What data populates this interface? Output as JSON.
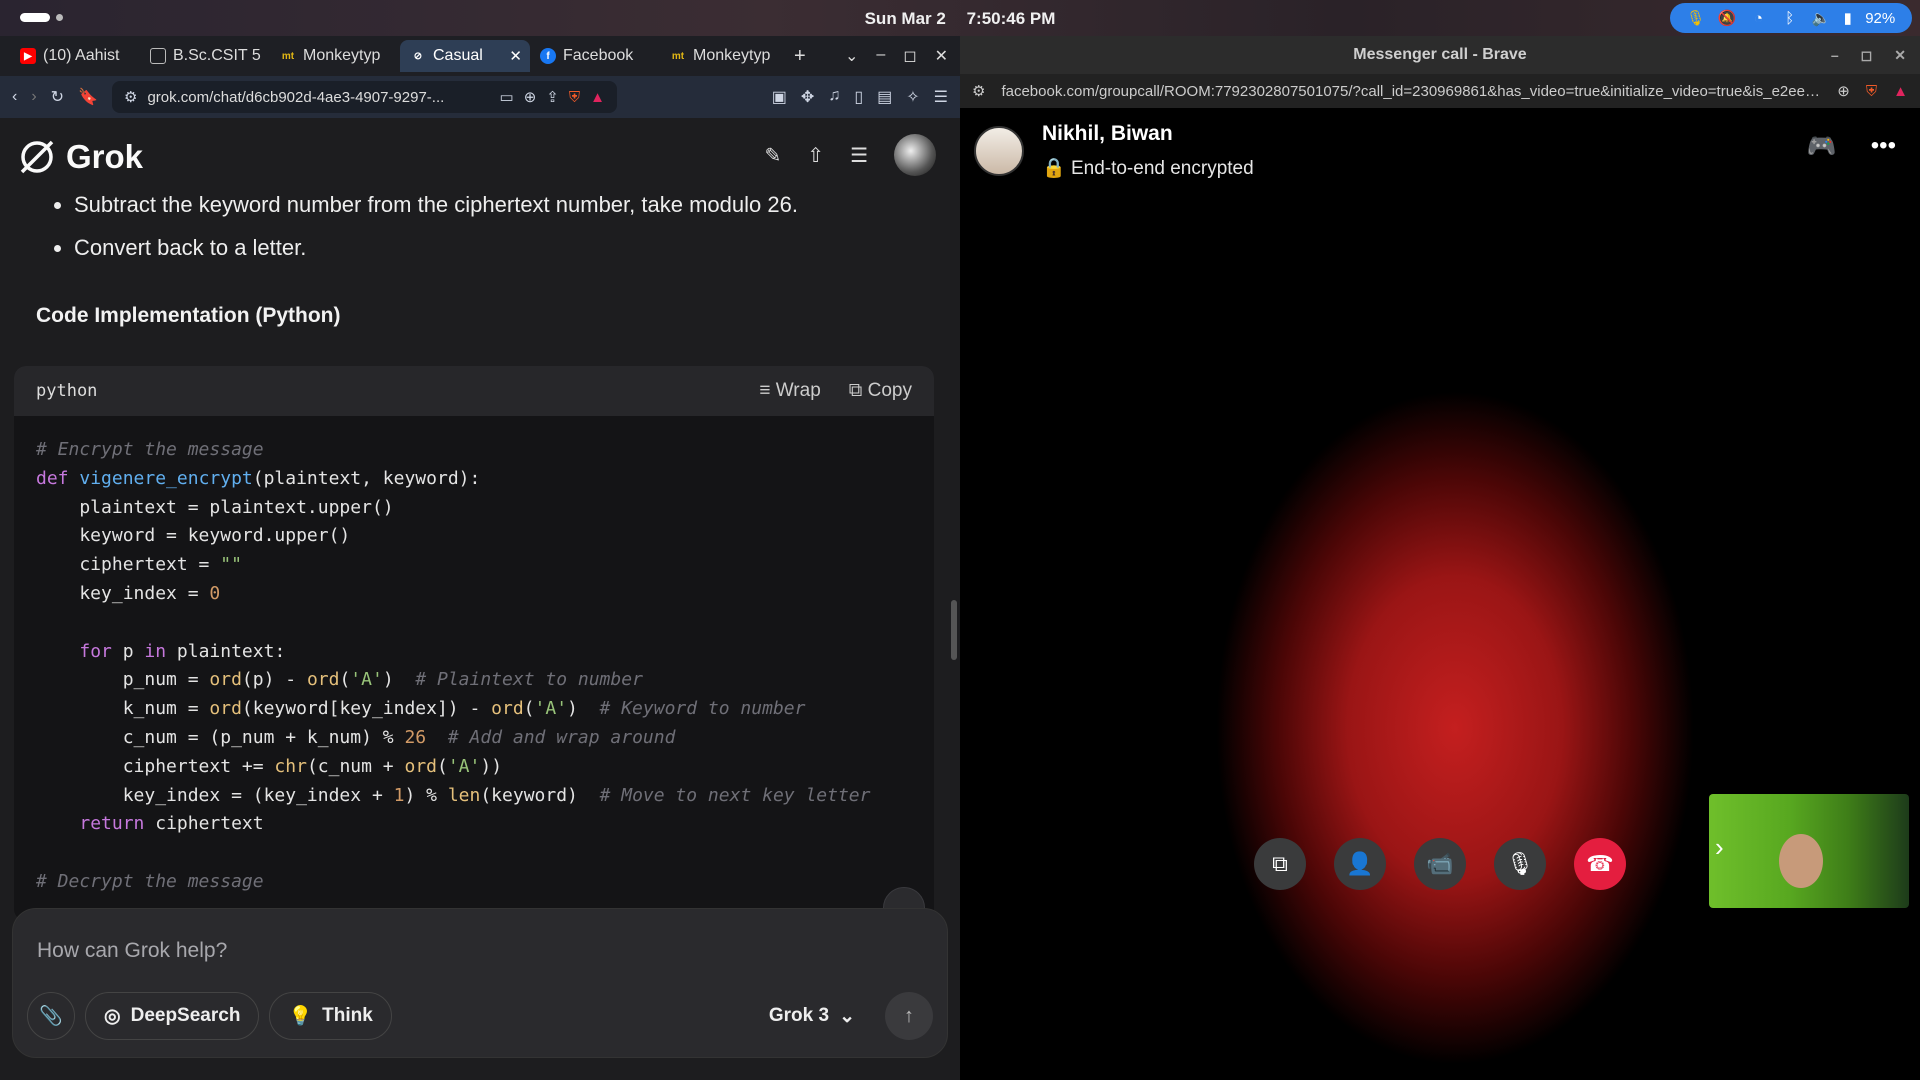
{
  "system": {
    "date": "Sun Mar 2",
    "time": "7:50:46 PM",
    "battery": "92%"
  },
  "left_browser": {
    "tabs": [
      {
        "label": "(10) Aahist",
        "icon": "youtube-icon",
        "color": "#ff0000"
      },
      {
        "label": "B.Sc.CSIT 5",
        "icon": "page-icon",
        "color": "#cccccc"
      },
      {
        "label": "Monkeytyp",
        "icon": "monkeytype-icon",
        "color": "#e2b714"
      },
      {
        "label": "Casual",
        "icon": "grok-icon",
        "color": "#ffffff",
        "active": true
      },
      {
        "label": "Facebook",
        "icon": "facebook-icon",
        "color": "#1877f2"
      },
      {
        "label": "Monkeytyp",
        "icon": "monkeytype-icon",
        "color": "#e2b714"
      }
    ],
    "url": "grok.com/chat/d6cb902d-4ae3-4907-9297-...",
    "app_name": "Grok",
    "bullets": [
      "Subtract the keyword number from the ciphertext number, take modulo 26.",
      "Convert back to a letter."
    ],
    "section_title": "Code Implementation (Python)",
    "code_lang": "python",
    "wrap_label": "Wrap",
    "copy_label": "Copy",
    "input_placeholder": "How can Grok help?",
    "deepsearch_label": "DeepSearch",
    "think_label": "Think",
    "model_label": "Grok 3"
  },
  "right_browser": {
    "window_title": "Messenger call - Brave",
    "url": "facebook.com/groupcall/ROOM:7792302807501075/?call_id=230969861&has_video=true&initialize_video=true&is_e2ee_man...",
    "call_name": "Nikhil, Biwan",
    "encryption_text": "End-to-end encrypted"
  }
}
